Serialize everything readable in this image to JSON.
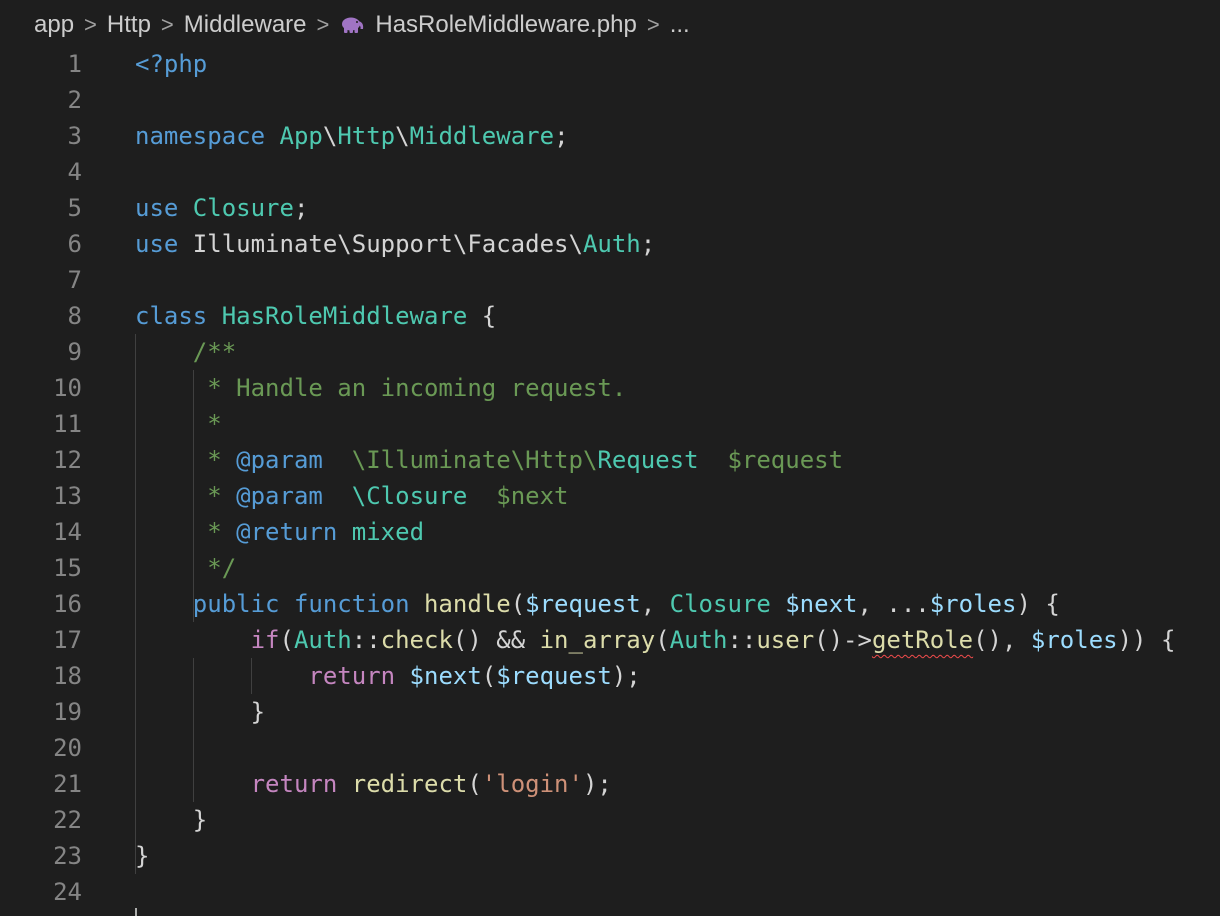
{
  "breadcrumb": {
    "items": [
      "app",
      "Http",
      "Middleware",
      "HasRoleMiddleware.php",
      "..."
    ],
    "separator": ">"
  },
  "colors": {
    "background": "#1e1e1e",
    "line_number": "#858585",
    "keyword": "#569cd6",
    "control": "#c586c0",
    "type": "#4ec9b0",
    "variable": "#9cdcfe",
    "function": "#dcdcaa",
    "string": "#ce9178",
    "comment": "#6a9955",
    "plain": "#d4d4d4",
    "php_icon": "#a074c4"
  },
  "editor": {
    "lines": [
      {
        "n": "1",
        "tokens": [
          {
            "t": "<?php",
            "c": "keyword"
          }
        ]
      },
      {
        "n": "2",
        "tokens": []
      },
      {
        "n": "3",
        "tokens": [
          {
            "t": "namespace ",
            "c": "keyword"
          },
          {
            "t": "App",
            "c": "type"
          },
          {
            "t": "\\",
            "c": "plain"
          },
          {
            "t": "Http",
            "c": "type"
          },
          {
            "t": "\\",
            "c": "plain"
          },
          {
            "t": "Middleware",
            "c": "type"
          },
          {
            "t": ";",
            "c": "plain"
          }
        ]
      },
      {
        "n": "4",
        "tokens": []
      },
      {
        "n": "5",
        "tokens": [
          {
            "t": "use ",
            "c": "keyword"
          },
          {
            "t": "Closure",
            "c": "type"
          },
          {
            "t": ";",
            "c": "plain"
          }
        ]
      },
      {
        "n": "6",
        "tokens": [
          {
            "t": "use ",
            "c": "keyword"
          },
          {
            "t": "Illuminate\\Support\\Facades\\",
            "c": "plain"
          },
          {
            "t": "Auth",
            "c": "type"
          },
          {
            "t": ";",
            "c": "plain"
          }
        ]
      },
      {
        "n": "7",
        "tokens": []
      },
      {
        "n": "8",
        "tokens": [
          {
            "t": "class ",
            "c": "keyword"
          },
          {
            "t": "HasRoleMiddleware",
            "c": "type"
          },
          {
            "t": " {",
            "c": "plain"
          }
        ]
      },
      {
        "n": "9",
        "tokens": [
          {
            "t": "    /**",
            "c": "comment"
          }
        ]
      },
      {
        "n": "10",
        "tokens": [
          {
            "t": "     * Handle an incoming request.",
            "c": "comment"
          }
        ]
      },
      {
        "n": "11",
        "tokens": [
          {
            "t": "     *",
            "c": "comment"
          }
        ]
      },
      {
        "n": "12",
        "tokens": [
          {
            "t": "     * ",
            "c": "comment"
          },
          {
            "t": "@param",
            "c": "keyword"
          },
          {
            "t": "  \\Illuminate\\Http\\",
            "c": "comment"
          },
          {
            "t": "Request",
            "c": "type"
          },
          {
            "t": "  $request",
            "c": "comment"
          }
        ]
      },
      {
        "n": "13",
        "tokens": [
          {
            "t": "     * ",
            "c": "comment"
          },
          {
            "t": "@param",
            "c": "keyword"
          },
          {
            "t": "  ",
            "c": "comment"
          },
          {
            "t": "\\Closure",
            "c": "type"
          },
          {
            "t": "  $next",
            "c": "comment"
          }
        ]
      },
      {
        "n": "14",
        "tokens": [
          {
            "t": "     * ",
            "c": "comment"
          },
          {
            "t": "@return",
            "c": "keyword"
          },
          {
            "t": " ",
            "c": "comment"
          },
          {
            "t": "mixed",
            "c": "type"
          }
        ]
      },
      {
        "n": "15",
        "tokens": [
          {
            "t": "     */",
            "c": "comment"
          }
        ]
      },
      {
        "n": "16",
        "tokens": [
          {
            "t": "    ",
            "c": "plain"
          },
          {
            "t": "public function ",
            "c": "keyword"
          },
          {
            "t": "handle",
            "c": "function"
          },
          {
            "t": "(",
            "c": "plain"
          },
          {
            "t": "$request",
            "c": "variable"
          },
          {
            "t": ", ",
            "c": "plain"
          },
          {
            "t": "Closure ",
            "c": "type"
          },
          {
            "t": "$next",
            "c": "variable"
          },
          {
            "t": ", ...",
            "c": "plain"
          },
          {
            "t": "$roles",
            "c": "variable"
          },
          {
            "t": ") {",
            "c": "plain"
          }
        ]
      },
      {
        "n": "17",
        "tokens": [
          {
            "t": "        ",
            "c": "plain"
          },
          {
            "t": "if",
            "c": "control"
          },
          {
            "t": "(",
            "c": "plain"
          },
          {
            "t": "Auth",
            "c": "type"
          },
          {
            "t": "::",
            "c": "plain"
          },
          {
            "t": "check",
            "c": "function"
          },
          {
            "t": "() && ",
            "c": "plain"
          },
          {
            "t": "in_array",
            "c": "function"
          },
          {
            "t": "(",
            "c": "plain"
          },
          {
            "t": "Auth",
            "c": "type"
          },
          {
            "t": "::",
            "c": "plain"
          },
          {
            "t": "user",
            "c": "function"
          },
          {
            "t": "()->",
            "c": "plain"
          },
          {
            "t": "getRole",
            "c": "function",
            "err": true
          },
          {
            "t": "(), ",
            "c": "plain"
          },
          {
            "t": "$roles",
            "c": "variable"
          },
          {
            "t": ")) {",
            "c": "plain"
          }
        ]
      },
      {
        "n": "18",
        "tokens": [
          {
            "t": "            ",
            "c": "plain"
          },
          {
            "t": "return ",
            "c": "control"
          },
          {
            "t": "$next",
            "c": "variable"
          },
          {
            "t": "(",
            "c": "plain"
          },
          {
            "t": "$request",
            "c": "variable"
          },
          {
            "t": ");",
            "c": "plain"
          }
        ]
      },
      {
        "n": "19",
        "tokens": [
          {
            "t": "        }",
            "c": "plain"
          }
        ]
      },
      {
        "n": "20",
        "tokens": []
      },
      {
        "n": "21",
        "tokens": [
          {
            "t": "        ",
            "c": "plain"
          },
          {
            "t": "return ",
            "c": "control"
          },
          {
            "t": "redirect",
            "c": "function"
          },
          {
            "t": "(",
            "c": "plain"
          },
          {
            "t": "'login'",
            "c": "string"
          },
          {
            "t": ");",
            "c": "plain"
          }
        ]
      },
      {
        "n": "22",
        "tokens": [
          {
            "t": "    }",
            "c": "plain"
          }
        ]
      },
      {
        "n": "23",
        "tokens": [
          {
            "t": "}",
            "c": "plain"
          }
        ]
      },
      {
        "n": "24",
        "tokens": []
      }
    ]
  }
}
